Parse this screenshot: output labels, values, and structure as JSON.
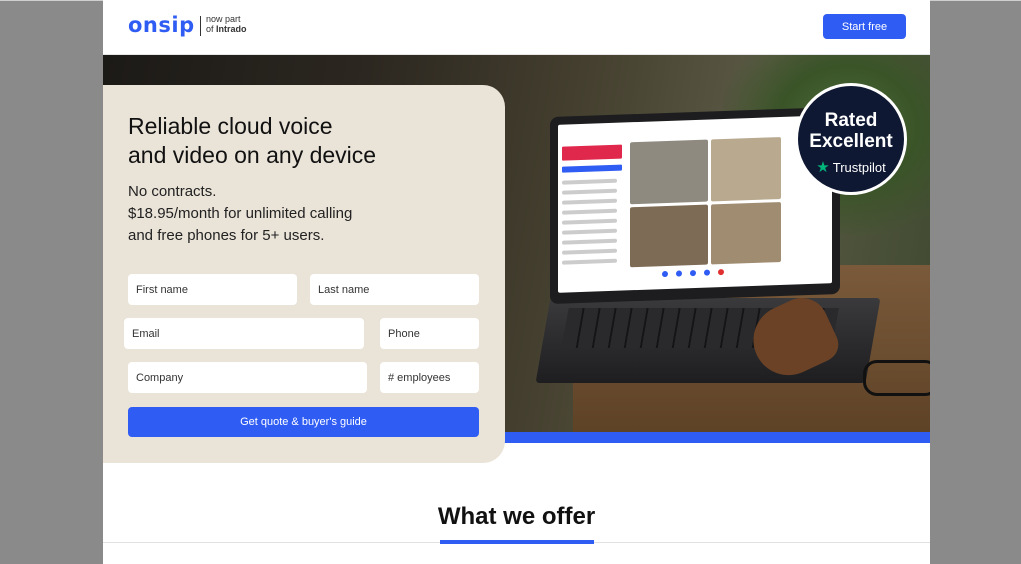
{
  "header": {
    "logo": "onsip",
    "tagline_line1": "now part",
    "tagline_line2_prefix": "of ",
    "tagline_line2_brand": "Intrado",
    "start_button": "Start free"
  },
  "hero": {
    "headline_line1": "Reliable cloud voice",
    "headline_line2": "and video on any device",
    "subtext_line1": "No contracts.",
    "subtext_line2": "$18.95/month for unlimited calling",
    "subtext_line3": "and free phones for 5+ users.",
    "badge_line1": "Rated",
    "badge_line2": "Excellent",
    "badge_brand": "Trustpilot"
  },
  "form": {
    "first_name_placeholder": "First name",
    "last_name_placeholder": "Last name",
    "email_placeholder": "Email",
    "phone_placeholder": "Phone",
    "company_placeholder": "Company",
    "employees_placeholder": "# employees",
    "submit_label": "Get quote & buyer's guide"
  },
  "section": {
    "title": "What we offer"
  },
  "colors": {
    "accent": "#2f5cf3",
    "card_bg": "#eae3d8",
    "badge_bg": "#0f1833",
    "trustpilot_green": "#00b67a"
  }
}
